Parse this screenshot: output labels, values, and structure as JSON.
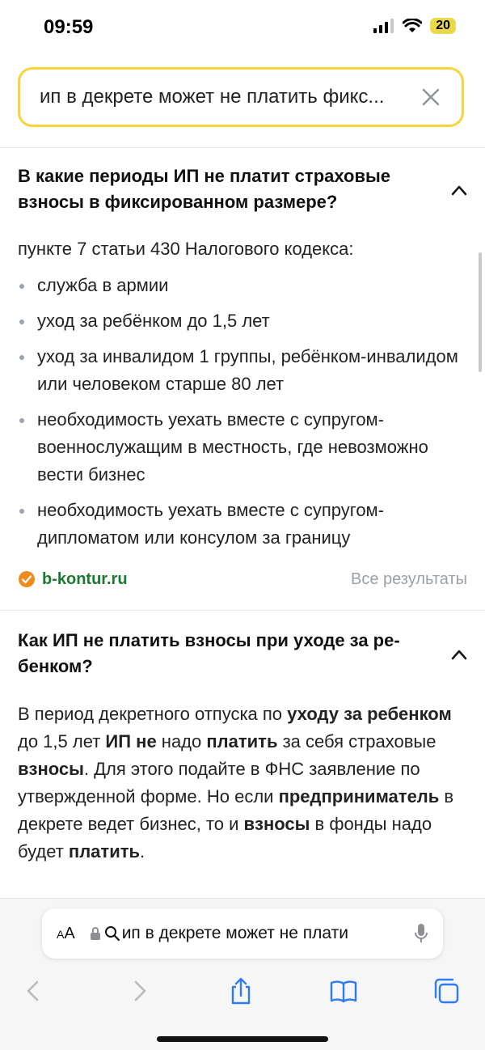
{
  "status": {
    "time": "09:59",
    "battery": "20"
  },
  "search": {
    "query": "ип в декрете может не платить фикс..."
  },
  "card1": {
    "title": "В какие периоды ИП не платит страховые взносы в фиксированном размере?",
    "lead": "пункте 7 статьи 430 Налогового кодекса:",
    "items": [
      "служба в армии",
      "уход за ребёнком до 1,5 лет",
      "уход за инвалидом 1 группы, ребёнком-инвалидом или человеком старше 80 лет",
      "необходимость уехать вместе с супругом-военнослужащим в местность, где невозможно вести бизнес",
      "необходимость уехать вместе с супругом-дипломатом или консулом за границу"
    ],
    "source": "b-kontur.ru",
    "all_results": "Все результаты"
  },
  "card2": {
    "title": "Как ИП не платить взносы при уходе за ре-бенком?",
    "paragraph": [
      {
        "t": "В период декретного отпуска по ",
        "b": false
      },
      {
        "t": "уходу за ребенком",
        "b": true
      },
      {
        "t": " до 1,5 лет ",
        "b": false
      },
      {
        "t": "ИП не",
        "b": true
      },
      {
        "t": " надо ",
        "b": false
      },
      {
        "t": "платить",
        "b": true
      },
      {
        "t": " за себя страховые ",
        "b": false
      },
      {
        "t": "взносы",
        "b": true
      },
      {
        "t": ". Для этого подайте в ФНС заявление по утвержденной форме. Но если ",
        "b": false
      },
      {
        "t": "предприниматель",
        "b": true
      },
      {
        "t": " в декрете ведет бизнес, то и ",
        "b": false
      },
      {
        "t": "взносы",
        "b": true
      },
      {
        "t": " в фонды надо будет ",
        "b": false
      },
      {
        "t": "платить",
        "b": true
      },
      {
        "t": ".",
        "b": false
      }
    ]
  },
  "browser": {
    "aa_label_small": "A",
    "aa_label": "A",
    "url_text": "ип в декрете может не плати"
  },
  "icons": {
    "clear": "close-icon",
    "chevron": "chevron-up-icon",
    "verified": "check-badge-icon",
    "lock": "lock-icon",
    "search": "search-icon",
    "mic": "microphone-icon",
    "back": "back-icon",
    "forward": "forward-icon",
    "share": "share-icon",
    "bookmarks": "book-icon",
    "tabs": "tabs-icon"
  },
  "colors": {
    "accent": "#f6d43a",
    "source": "#1a7a2f",
    "safari_blue": "#2f7bf5"
  }
}
